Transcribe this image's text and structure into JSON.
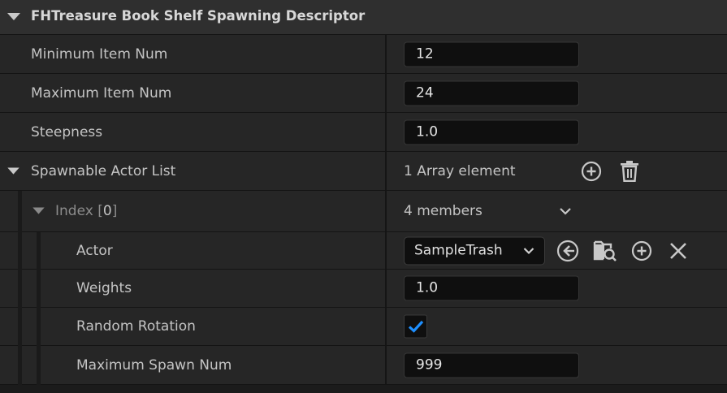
{
  "header": {
    "title": "FHTreasure Book Shelf Spawning Descriptor"
  },
  "rows": {
    "min_item": {
      "label": "Minimum Item Num",
      "value": "12"
    },
    "max_item": {
      "label": "Maximum Item Num",
      "value": "24"
    },
    "steepness": {
      "label": "Steepness",
      "value": "1.0"
    },
    "actor_list": {
      "label": "Spawnable Actor List",
      "value": "1 Array element"
    },
    "index": {
      "label": "Index",
      "bracket_open": "[",
      "index": "0",
      "bracket_close": "]",
      "value": "4 members"
    },
    "actor": {
      "label": "Actor",
      "value": "SampleTrash"
    },
    "weights": {
      "label": "Weights",
      "value": "1.0"
    },
    "random_rotation": {
      "label": "Random Rotation",
      "checked": true
    },
    "max_spawn": {
      "label": "Maximum Spawn Num",
      "value": "999"
    }
  },
  "icons": {
    "section_toggle": "triangle-down-icon",
    "add": "plus-circle-icon",
    "delete": "trash-icon",
    "expand": "chevron-down-icon",
    "use_selected": "arrow-left-circle-icon",
    "browse": "folder-search-icon",
    "clear": "close-icon",
    "check": "checkmark-icon"
  },
  "colors": {
    "accent": "#1e8fff",
    "panel": "#262626",
    "field": "#0f0f0f"
  }
}
